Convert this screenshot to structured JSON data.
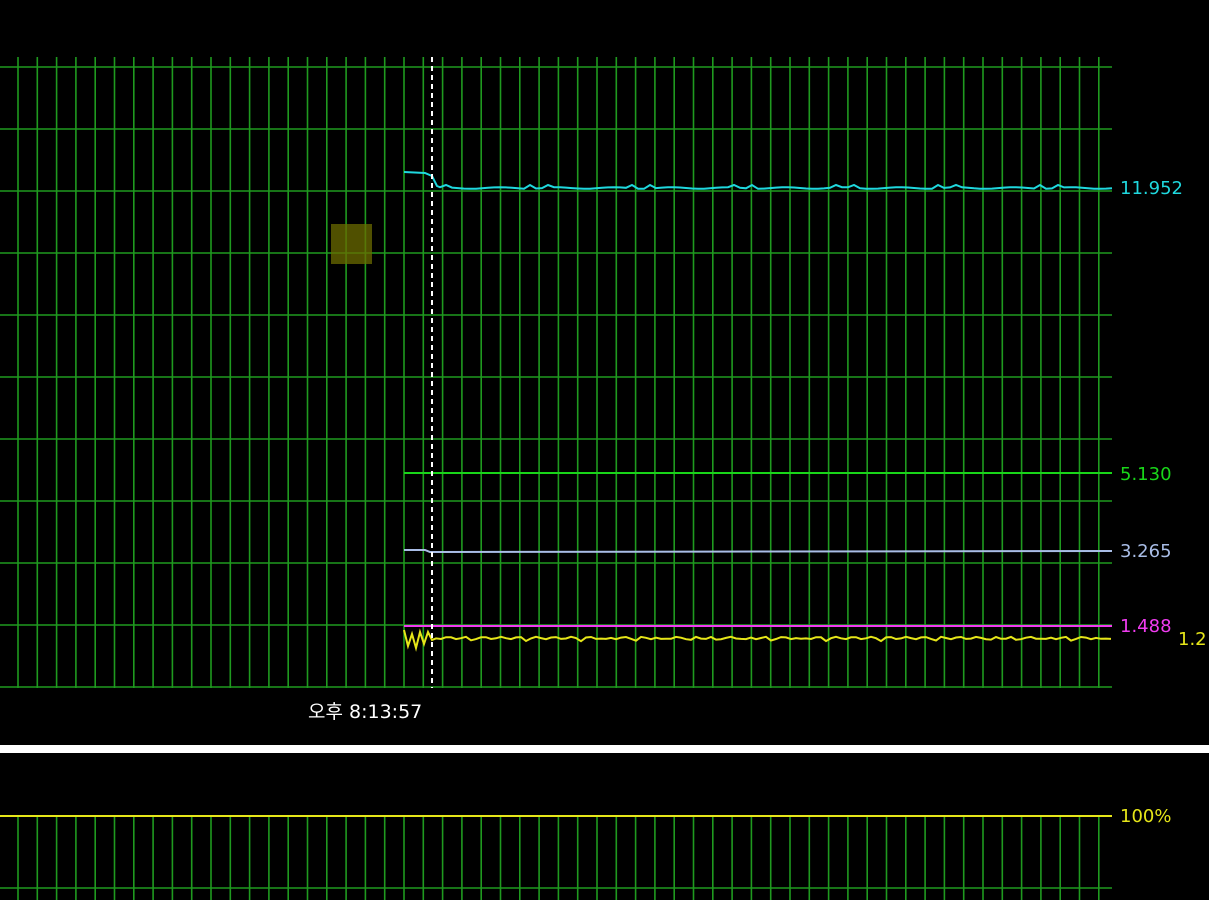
{
  "monitor": {
    "time_label": "오후 8:13:57",
    "colors": {
      "background": "#000000",
      "grid": "#1f9a1f",
      "marker": "#ffffff",
      "divider": "#ffffff",
      "overlay_text": "#6b6b00"
    },
    "series": [
      {
        "id": "cyan",
        "value_label": "11.952",
        "color": "#1fd8de"
      },
      {
        "id": "green",
        "value_label": "5.130",
        "color": "#19d619"
      },
      {
        "id": "blue",
        "value_label": "3.265",
        "color": "#a9bde6"
      },
      {
        "id": "magenta",
        "value_label": "1.488",
        "color": "#f03cf0"
      },
      {
        "id": "yellow",
        "value_label": "1.2",
        "color": "#e6e619"
      }
    ],
    "lower_panel": {
      "value_label": "100%",
      "color": "#e6e619"
    }
  }
}
